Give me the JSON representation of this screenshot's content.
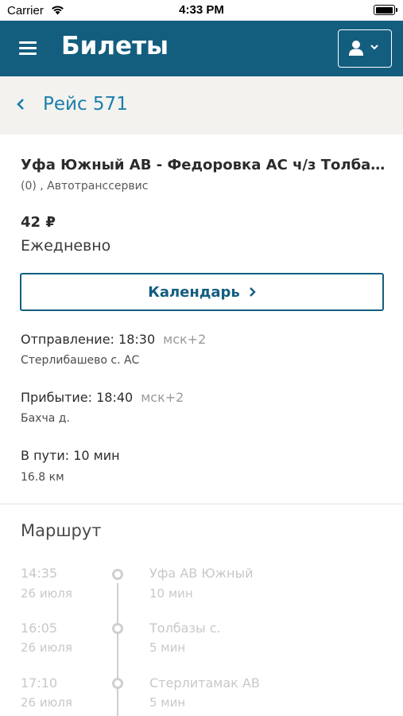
{
  "status_bar": {
    "carrier": "Carrier",
    "time": "4:33 PM",
    "battery_level": 0.9
  },
  "header": {
    "title": "Билеты",
    "menu_icon": "hamburger-menu-icon",
    "user_icon": "user-icon",
    "dropdown_icon": "chevron-down-icon",
    "accent_color": "#135e7e"
  },
  "breadcrumb": {
    "back_icon": "chevron-left-icon",
    "title": "Рейс 571"
  },
  "trip": {
    "route": "Уфа Южный АВ - Федоровка АС ч/з Толбазы ...",
    "carrier": "(0) , Автотранссервис",
    "price": "42 ₽",
    "schedule": "Ежедневно",
    "calendar_button": "Календарь"
  },
  "departure": {
    "label": "Отправление: 18:30",
    "tz": "мск+2",
    "station": "Стерлибашево с. АС"
  },
  "arrival": {
    "label": "Прибытие: 18:40",
    "tz": "мск+2",
    "station": "Бахча д."
  },
  "duration": {
    "label": "В пути: 10 мин",
    "distance": "16.8 км"
  },
  "route_section": {
    "title": "Маршрут",
    "stops": [
      {
        "time": "14:35",
        "date": "26 июля",
        "name": "Уфа АВ Южный",
        "duration": "10 мин"
      },
      {
        "time": "16:05",
        "date": "26 июля",
        "name": "Толбазы с.",
        "duration": "5 мин"
      },
      {
        "time": "17:10",
        "date": "26 июля",
        "name": "Стерлитамак АВ",
        "duration": "5 мин"
      }
    ]
  }
}
